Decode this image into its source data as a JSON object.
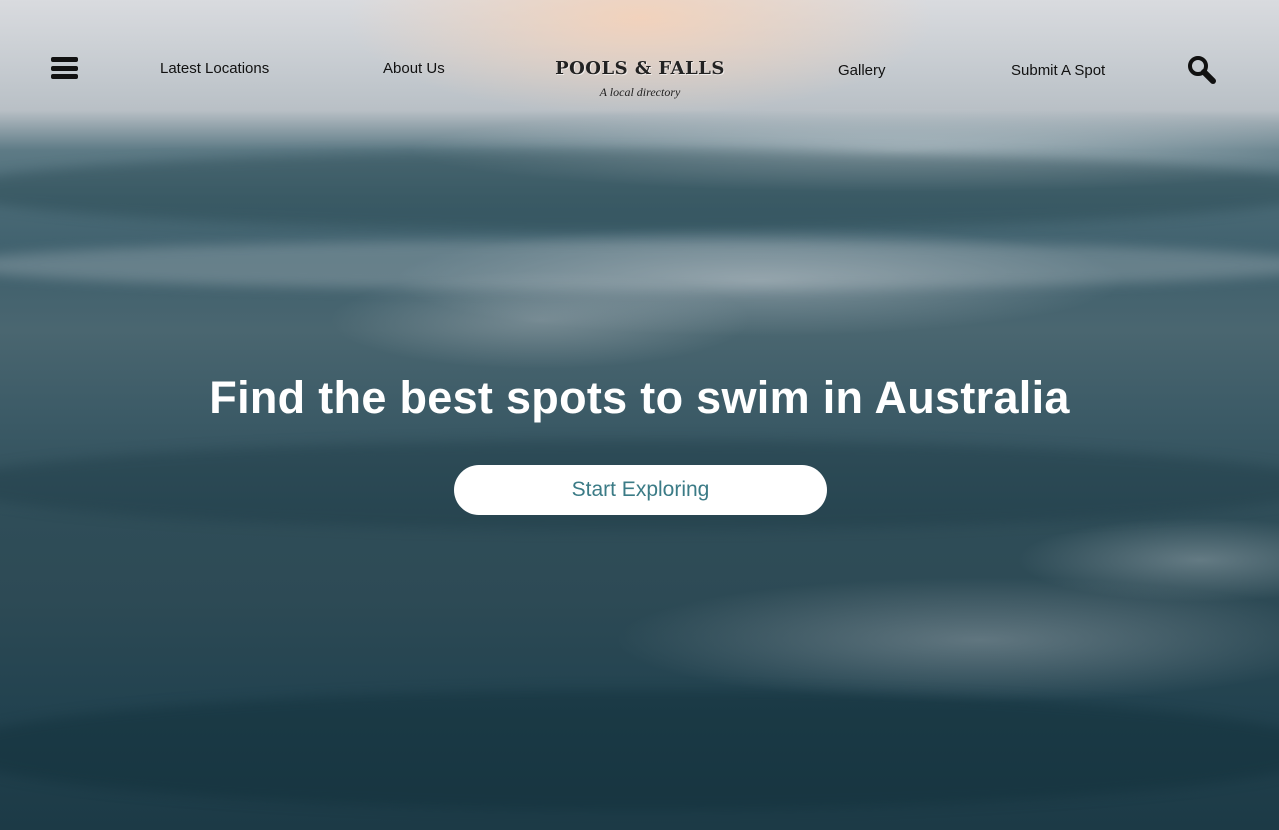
{
  "nav": {
    "menu_icon": "hamburger-menu-icon",
    "links": [
      {
        "label": "Latest Locations"
      },
      {
        "label": "About Us"
      },
      {
        "label": "Gallery"
      },
      {
        "label": "Submit A Spot"
      }
    ],
    "search_icon": "search-icon"
  },
  "logo": {
    "title": "POOLS & FALLS",
    "subtitle": "A local directory"
  },
  "hero": {
    "headline": "Find the best spots to swim in Australia",
    "cta_label": "Start Exploring",
    "cta_text_color": "#3b7b86"
  }
}
